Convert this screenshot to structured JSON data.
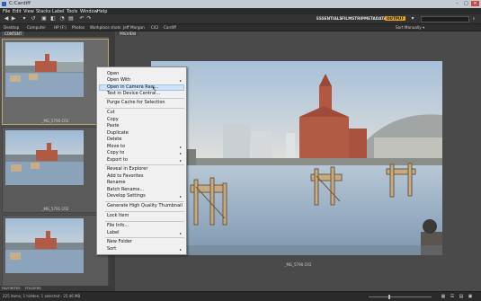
{
  "window": {
    "title": "C:Cardiff",
    "min": "–",
    "max": "□",
    "close": "✕"
  },
  "menubar": [
    "File",
    "Edit",
    "View",
    "Stacks",
    "Label",
    "Tools",
    "Window",
    "Help"
  ],
  "workspaces": {
    "essentials": "ESSENTIALS",
    "filmstrip": "FILMSTRIP",
    "metadata": "METADATA",
    "output": "OUTPUT"
  },
  "pathbar": {
    "crumbs": [
      "Desktop",
      "Computer",
      "HP (F:)",
      "Photos",
      "Workplace shots",
      "Jeff Morgan",
      "C42",
      "Cardiff"
    ],
    "sort": "Sort Manually ▾"
  },
  "panels": {
    "content_tab": "CONTENT",
    "preview_tab": "PREVIEW",
    "bottom_tab_1": "FAVORITES",
    "bottom_tab_2": "FOLDERS"
  },
  "thumbnails": [
    {
      "label": "_MG_5790.CR2"
    },
    {
      "label": "_MG_5791.CR2"
    },
    {
      "label": "_MG_5792.CR2"
    }
  ],
  "preview": {
    "caption": "_MG_5790.CR2"
  },
  "statusbar": {
    "text": "225 items, 1 hidden, 1 selected - 25.46 MB"
  },
  "context_menu": {
    "items": [
      "Open",
      "Open With",
      "Open in Camera Raw...",
      "Test in Device Central...",
      "Purge Cache for Selection",
      "Cut",
      "Copy",
      "Paste",
      "Duplicate",
      "Delete",
      "Move to",
      "Copy to",
      "Export to",
      "Reveal in Explorer",
      "Add to Favorites",
      "Rename",
      "Batch Rename...",
      "Develop Settings",
      "Generate High Quality Thumbnail",
      "Lock Item",
      "File Info...",
      "Label",
      "New Folder",
      "Sort"
    ]
  },
  "colors": {
    "accent": "#e8a623",
    "menu_highlight": "#cfe2f6",
    "sky_top": "#9bbcd8",
    "water": "#8fa9c1",
    "brick": "#b05a44"
  }
}
